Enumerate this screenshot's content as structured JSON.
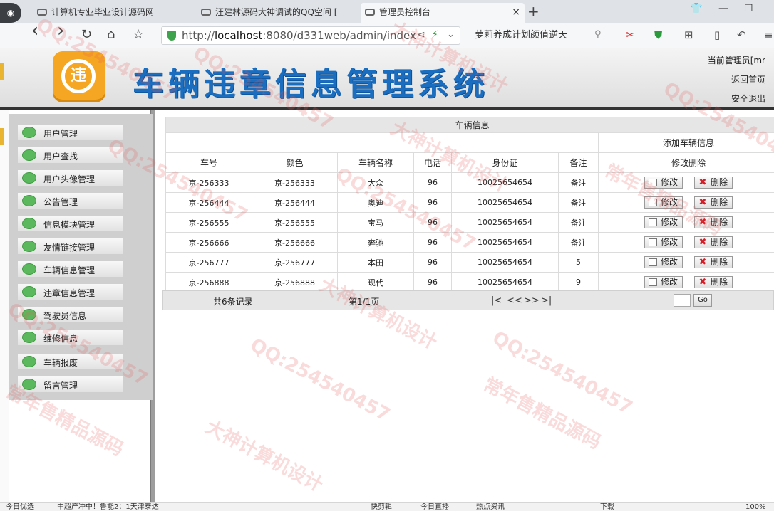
{
  "browser": {
    "tabs": [
      {
        "label": "计算机专业毕业设计源码网"
      },
      {
        "label": "汪建林源码大神调试的QQ空间 ["
      },
      {
        "label": "管理员控制台"
      }
    ],
    "url_prefix": "http://",
    "url_host": "localhost",
    "url_rest": ":8080/d331web/admin/index",
    "search_text": "萝莉养成计划颜值逆天",
    "buttons": {
      "back": "‹",
      "forward": "›",
      "reload": "↻",
      "home": "⌂",
      "star": "☆",
      "new_tab": "+",
      "close_tab": "×"
    }
  },
  "header": {
    "logo_char": "违",
    "title": "车辆违章信息管理系统",
    "admin_label": "当前管理员[mr",
    "home_link": "返回首页",
    "logout_link": "安全退出"
  },
  "sidebar": {
    "items": [
      {
        "label": "用户管理"
      },
      {
        "label": "用户查找"
      },
      {
        "label": "用户头像管理"
      },
      {
        "label": "公告管理"
      },
      {
        "label": "信息模块管理"
      },
      {
        "label": "友情链接管理"
      },
      {
        "label": "车辆信息管理"
      },
      {
        "label": "违章信息管理"
      },
      {
        "label": "驾驶员信息"
      },
      {
        "label": "维修信息"
      },
      {
        "label": "车辆报废"
      },
      {
        "label": "留言管理"
      }
    ]
  },
  "table": {
    "caption": "车辆信息",
    "add_link": "添加车辆信息",
    "columns": [
      "车号",
      "颜色",
      "车辆名称",
      "电话",
      "身份证",
      "备注",
      "修改删除"
    ],
    "edit_label": "修改",
    "delete_label": "删除",
    "rows": [
      {
        "plate": "京-256333",
        "color": "京-256333",
        "name": "大众",
        "phone": "96",
        "id_card": "10025654654",
        "note": "备注"
      },
      {
        "plate": "京-256444",
        "color": "京-256444",
        "name": "奥迪",
        "phone": "96",
        "id_card": "10025654654",
        "note": "备注"
      },
      {
        "plate": "京-256555",
        "color": "京-256555",
        "name": "宝马",
        "phone": "96",
        "id_card": "10025654654",
        "note": "备注"
      },
      {
        "plate": "京-256666",
        "color": "京-256666",
        "name": "奔驰",
        "phone": "96",
        "id_card": "10025654654",
        "note": "备注"
      },
      {
        "plate": "京-256777",
        "color": "京-256777",
        "name": "本田",
        "phone": "96",
        "id_card": "10025654654",
        "note": "5"
      },
      {
        "plate": "京-256888",
        "color": "京-256888",
        "name": "现代",
        "phone": "96",
        "id_card": "10025654654",
        "note": "9"
      }
    ]
  },
  "pager": {
    "total": "共6条记录",
    "page": "第1/1页",
    "first": "|<",
    "prev": "<<",
    "next": ">>",
    "last": ">|",
    "go": "Go"
  },
  "watermarks": [
    "QQ:254540457",
    "常年售精品源码",
    "大神计算机设计"
  ],
  "status": {
    "left": "今日优选",
    "news": "中超产冲中！鲁能2：1天津泰达",
    "item1": "快剪辑",
    "item2": "今日直播",
    "item3": "热点资讯",
    "download": "下载",
    "zoom": "100%"
  }
}
